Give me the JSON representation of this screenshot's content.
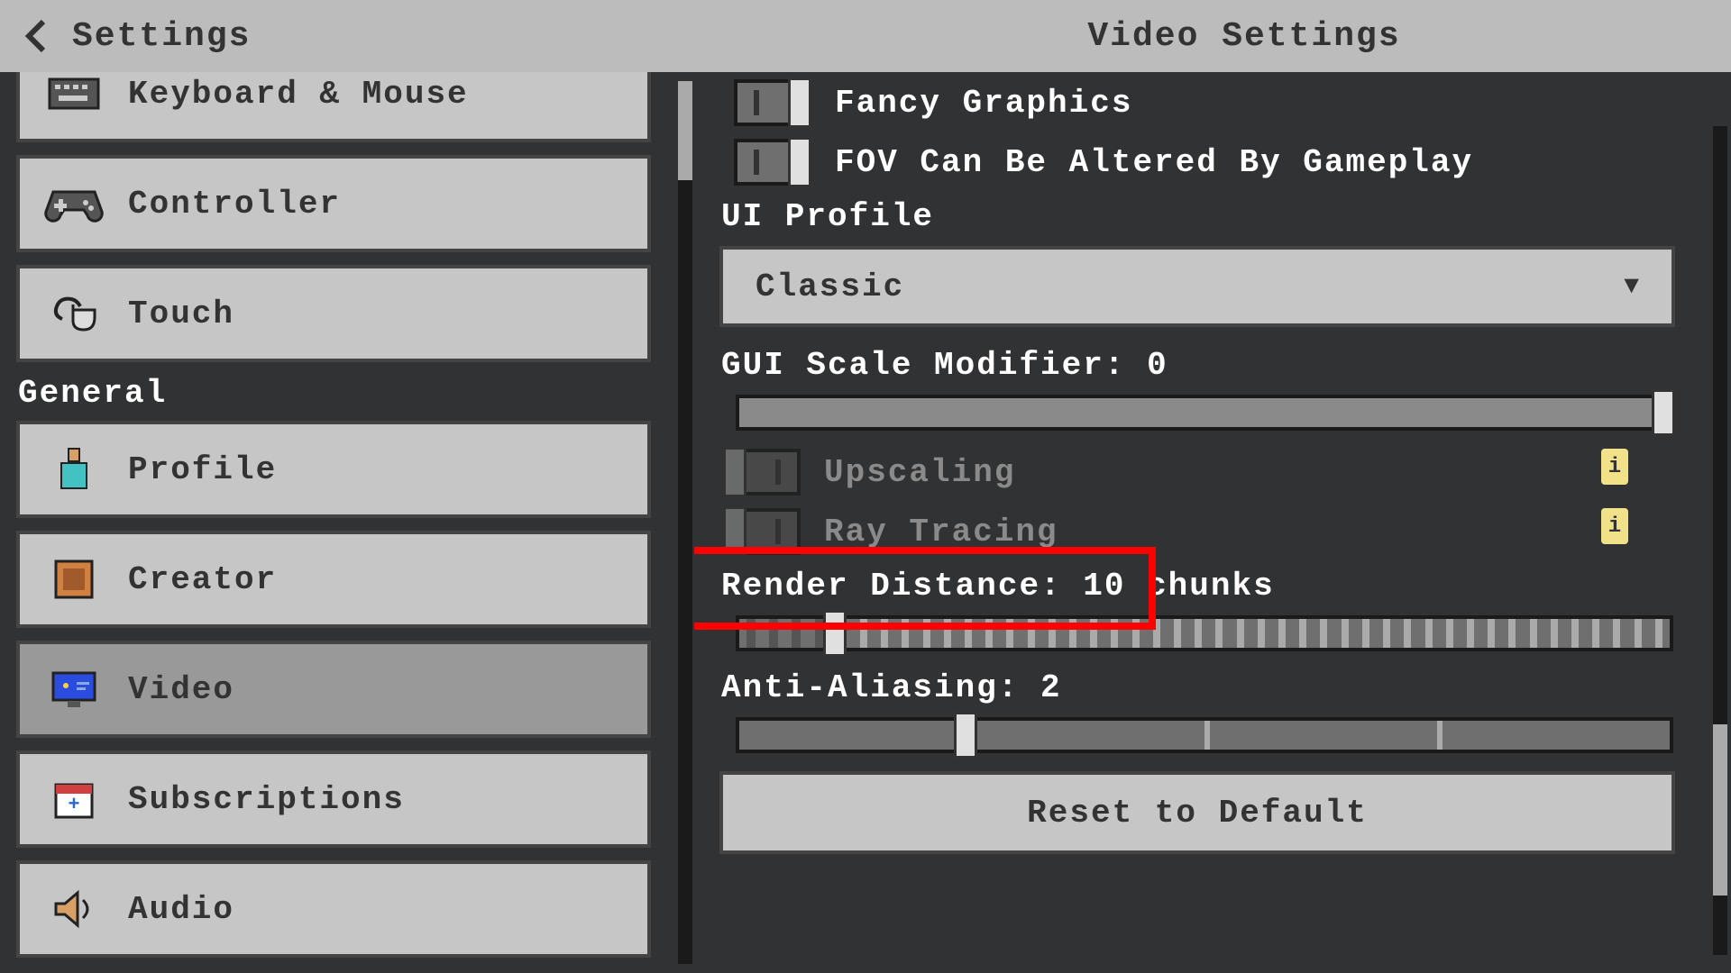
{
  "header": {
    "back_label": "Settings",
    "title": "Video Settings"
  },
  "sidebar": {
    "section_general": "General",
    "items": [
      {
        "label": "Keyboard & Mouse",
        "icon": "keyboard-icon"
      },
      {
        "label": "Controller",
        "icon": "gamepad-icon"
      },
      {
        "label": "Touch",
        "icon": "touch-icon"
      },
      {
        "label": "Profile",
        "icon": "profile-icon"
      },
      {
        "label": "Creator",
        "icon": "creator-icon"
      },
      {
        "label": "Video",
        "icon": "monitor-icon",
        "active": true
      },
      {
        "label": "Subscriptions",
        "icon": "calendar-icon"
      },
      {
        "label": "Audio",
        "icon": "speaker-icon"
      }
    ]
  },
  "main": {
    "toggles": {
      "fancy_graphics": {
        "label": "Fancy Graphics",
        "on": true
      },
      "fov_gameplay": {
        "label": "FOV Can Be Altered By Gameplay",
        "on": true
      },
      "upscaling": {
        "label": "Upscaling",
        "on": false,
        "disabled": true
      },
      "ray_tracing": {
        "label": "Ray Tracing",
        "on": false,
        "disabled": true
      }
    },
    "ui_profile": {
      "label": "UI Profile",
      "value": "Classic"
    },
    "gui_scale": {
      "label": "GUI Scale Modifier: 0",
      "value": 0,
      "pct": 100
    },
    "render_distance": {
      "label": "Render Distance: 10 chunks",
      "value": 10,
      "pct": 10
    },
    "anti_aliasing": {
      "label": "Anti-Aliasing: 2",
      "value": 2,
      "pct": 24
    },
    "reset_label": "Reset to Default"
  },
  "highlight": {
    "target": "ray_tracing"
  }
}
